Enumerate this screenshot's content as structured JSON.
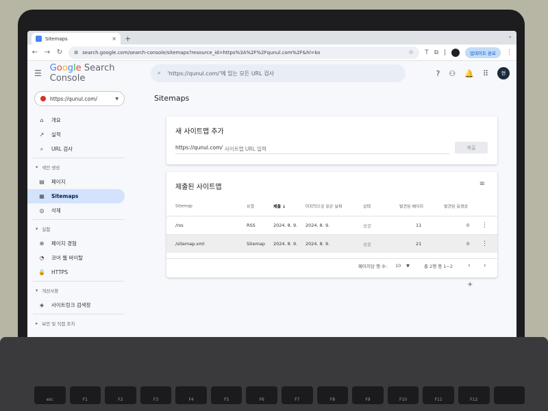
{
  "browser": {
    "tab_title": "Sitemaps",
    "tab_close": "×",
    "new_tab": "+",
    "url": "search.google.com/search-console/sitemaps?resource_id=https%3A%2F%2Fqunul.com%2F&hl=ko",
    "update_label": "업데이트 완료"
  },
  "app": {
    "brand_google": [
      "G",
      "o",
      "o",
      "g",
      "l",
      "e"
    ],
    "brand_product": "Search Console",
    "search_placeholder": "'https://qunul.com/'에 있는 모든 URL 검사",
    "avatar_letter": "현"
  },
  "sidebar": {
    "property": "https://qunul.com/",
    "items_top": [
      {
        "icon": "⌂",
        "label": "개요"
      },
      {
        "icon": "↗",
        "label": "실적"
      },
      {
        "icon": "⌕",
        "label": "URL 검사"
      }
    ],
    "section_index": "색인 생성",
    "items_index": [
      {
        "icon": "▤",
        "label": "페이지"
      },
      {
        "icon": "▦",
        "label": "Sitemaps"
      },
      {
        "icon": "◎",
        "label": "삭제"
      }
    ],
    "section_experience": "실험",
    "items_experience": [
      {
        "icon": "⊕",
        "label": "페이지 경험"
      },
      {
        "icon": "◔",
        "label": "코어 웹 바이탈"
      },
      {
        "icon": "🔒",
        "label": "HTTPS"
      }
    ],
    "section_enhancements": "개선사항",
    "items_enhancements": [
      {
        "icon": "◈",
        "label": "사이트링크 검색창"
      }
    ],
    "section_security": "보안 및 직접 조치"
  },
  "main": {
    "page_title": "Sitemaps",
    "add_card": {
      "title": "새 사이트맵 추가",
      "url_prefix": "https://qunul.com/",
      "input_placeholder": "사이트맵 URL 입력",
      "submit_label": "제출"
    },
    "submitted_card": {
      "title": "제출된 사이트맵",
      "headers": [
        "Sitemap",
        "유형",
        "제출 ↓",
        "마지막으로 읽은 날짜",
        "상태",
        "발견된 페이지",
        "발견된 동영상"
      ],
      "rows": [
        {
          "sitemap": "/rss",
          "type": "RSS",
          "submitted": "2024. 8. 9.",
          "last_read": "2024. 8. 9.",
          "status": "성공",
          "pages": "11",
          "videos": "0"
        },
        {
          "sitemap": "/sitemap.xml",
          "type": "Sitemap",
          "submitted": "2024. 8. 9.",
          "last_read": "2024. 8. 9.",
          "status": "성공",
          "pages": "21",
          "videos": "0"
        }
      ],
      "rows_per_page_label": "페이지당 행 수:",
      "rows_per_page": "10",
      "range": "총 2행 중 1~2"
    }
  }
}
